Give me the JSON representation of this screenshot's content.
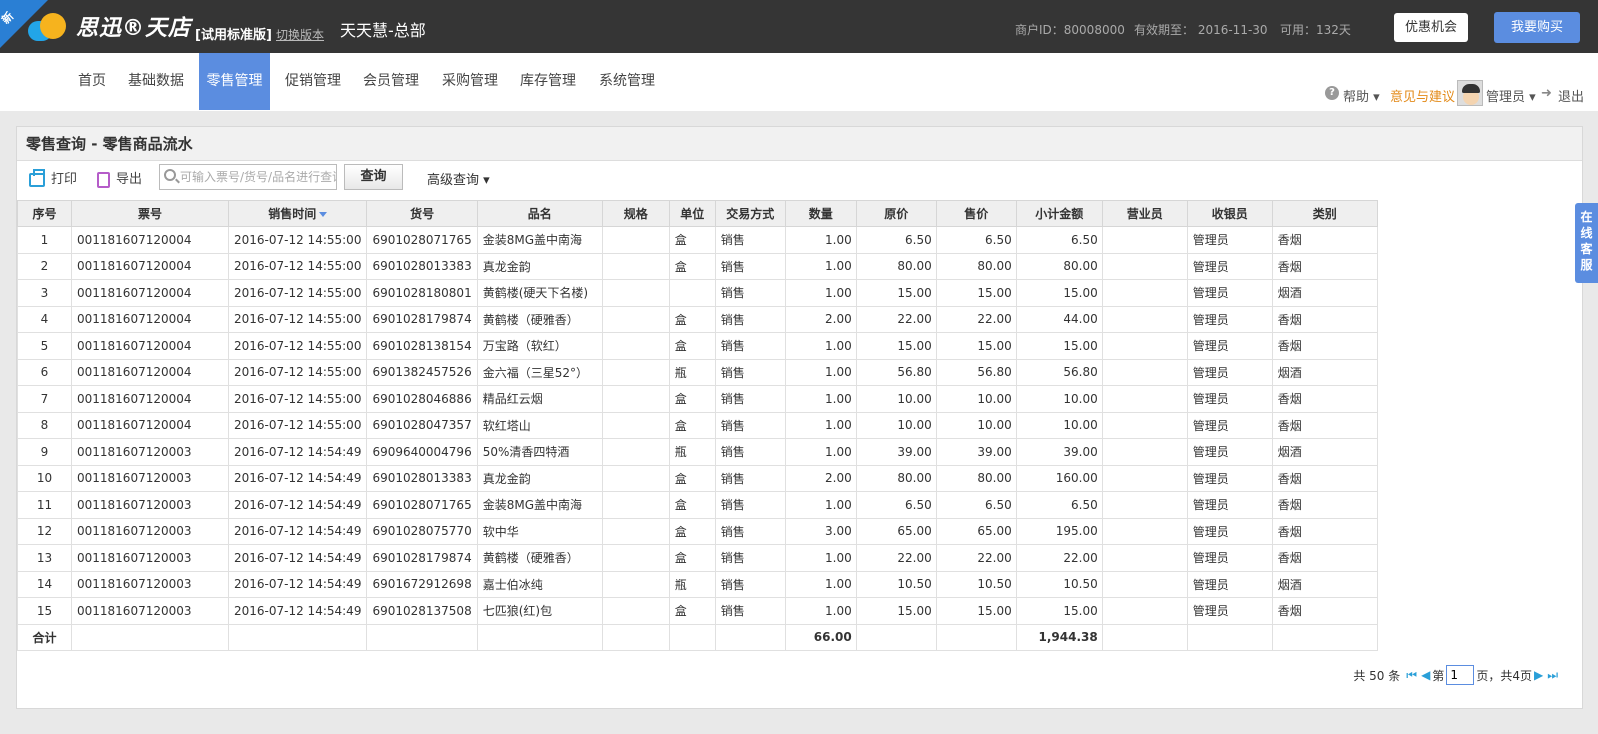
{
  "badge": "新",
  "logo": {
    "text": "思迅®天店"
  },
  "header": {
    "edition": "[试用标准版]",
    "switch_version": "切换版本",
    "store_name": "天天慧-总部",
    "merchant_id": "商户ID：80008000",
    "valid_until": "有效期至：  2016-11-30",
    "available": "可用：132天",
    "discount_button": "优惠机会",
    "buy_button": "我要购买"
  },
  "nav": {
    "items": [
      "首页",
      "基础数据",
      "零售管理",
      "促销管理",
      "会员管理",
      "采购管理",
      "库存管理",
      "系统管理"
    ],
    "active_index": 2,
    "help": "帮助 ▾",
    "feedback": "意见与建议",
    "user": "管理员 ▾",
    "logout": "退出"
  },
  "colors": {
    "accent": "#5b8de0",
    "topbar": "#353535",
    "feedback": "#e38b1a"
  },
  "panel": {
    "title": "零售查询 - 零售商品流水",
    "print": "打印",
    "export": "导出",
    "search_placeholder": "可输入票号/货号/品名进行查询",
    "query_button": "查询",
    "advanced_query": "高级查询 ▾"
  },
  "table": {
    "columns": [
      "序号",
      "票号",
      "销售时间",
      "货号",
      "品名",
      "规格",
      "单位",
      "交易方式",
      "数量",
      "原价",
      "售价",
      "小计金额",
      "营业员",
      "收银员",
      "类别"
    ],
    "rows": [
      [
        "1",
        "001181607120004",
        "2016-07-12 14:55:00",
        "6901028071765",
        "金装8MG盖中南海",
        "",
        "盒",
        "销售",
        "1.00",
        "6.50",
        "6.50",
        "6.50",
        "",
        "管理员",
        "香烟"
      ],
      [
        "2",
        "001181607120004",
        "2016-07-12 14:55:00",
        "6901028013383",
        "真龙金韵",
        "",
        "盒",
        "销售",
        "1.00",
        "80.00",
        "80.00",
        "80.00",
        "",
        "管理员",
        "香烟"
      ],
      [
        "3",
        "001181607120004",
        "2016-07-12 14:55:00",
        "6901028180801",
        "黄鹤楼(硬天下名楼)",
        "",
        "",
        "销售",
        "1.00",
        "15.00",
        "15.00",
        "15.00",
        "",
        "管理员",
        "烟酒"
      ],
      [
        "4",
        "001181607120004",
        "2016-07-12 14:55:00",
        "6901028179874",
        "黄鹤楼（硬雅香）",
        "",
        "盒",
        "销售",
        "2.00",
        "22.00",
        "22.00",
        "44.00",
        "",
        "管理员",
        "香烟"
      ],
      [
        "5",
        "001181607120004",
        "2016-07-12 14:55:00",
        "6901028138154",
        "万宝路（软红）",
        "",
        "盒",
        "销售",
        "1.00",
        "15.00",
        "15.00",
        "15.00",
        "",
        "管理员",
        "香烟"
      ],
      [
        "6",
        "001181607120004",
        "2016-07-12 14:55:00",
        "6901382457526",
        "金六福（三星52°）",
        "",
        "瓶",
        "销售",
        "1.00",
        "56.80",
        "56.80",
        "56.80",
        "",
        "管理员",
        "烟酒"
      ],
      [
        "7",
        "001181607120004",
        "2016-07-12 14:55:00",
        "6901028046886",
        "精品红云烟",
        "",
        "盒",
        "销售",
        "1.00",
        "10.00",
        "10.00",
        "10.00",
        "",
        "管理员",
        "香烟"
      ],
      [
        "8",
        "001181607120004",
        "2016-07-12 14:55:00",
        "6901028047357",
        "软红塔山",
        "",
        "盒",
        "销售",
        "1.00",
        "10.00",
        "10.00",
        "10.00",
        "",
        "管理员",
        "香烟"
      ],
      [
        "9",
        "001181607120003",
        "2016-07-12 14:54:49",
        "6909640004796",
        "50%清香四特酒",
        "",
        "瓶",
        "销售",
        "1.00",
        "39.00",
        "39.00",
        "39.00",
        "",
        "管理员",
        "烟酒"
      ],
      [
        "10",
        "001181607120003",
        "2016-07-12 14:54:49",
        "6901028013383",
        "真龙金韵",
        "",
        "盒",
        "销售",
        "2.00",
        "80.00",
        "80.00",
        "160.00",
        "",
        "管理员",
        "香烟"
      ],
      [
        "11",
        "001181607120003",
        "2016-07-12 14:54:49",
        "6901028071765",
        "金装8MG盖中南海",
        "",
        "盒",
        "销售",
        "1.00",
        "6.50",
        "6.50",
        "6.50",
        "",
        "管理员",
        "香烟"
      ],
      [
        "12",
        "001181607120003",
        "2016-07-12 14:54:49",
        "6901028075770",
        "软中华",
        "",
        "盒",
        "销售",
        "3.00",
        "65.00",
        "65.00",
        "195.00",
        "",
        "管理员",
        "香烟"
      ],
      [
        "13",
        "001181607120003",
        "2016-07-12 14:54:49",
        "6901028179874",
        "黄鹤楼（硬雅香）",
        "",
        "盒",
        "销售",
        "1.00",
        "22.00",
        "22.00",
        "22.00",
        "",
        "管理员",
        "香烟"
      ],
      [
        "14",
        "001181607120003",
        "2016-07-12 14:54:49",
        "6901672912698",
        "嘉士伯冰纯",
        "",
        "瓶",
        "销售",
        "1.00",
        "10.50",
        "10.50",
        "10.50",
        "",
        "管理员",
        "烟酒"
      ],
      [
        "15",
        "001181607120003",
        "2016-07-12 14:54:49",
        "6901028137508",
        "七匹狼(红)包",
        "",
        "盒",
        "销售",
        "1.00",
        "15.00",
        "15.00",
        "15.00",
        "",
        "管理员",
        "香烟"
      ]
    ],
    "total": {
      "label": "合计",
      "quantity": "66.00",
      "amount": "1,944.38"
    }
  },
  "pager": {
    "total_text": "共 50 条",
    "page_prefix": "第",
    "current_page": "1",
    "page_suffix": "页，共4页"
  },
  "online_service": "在线客服"
}
